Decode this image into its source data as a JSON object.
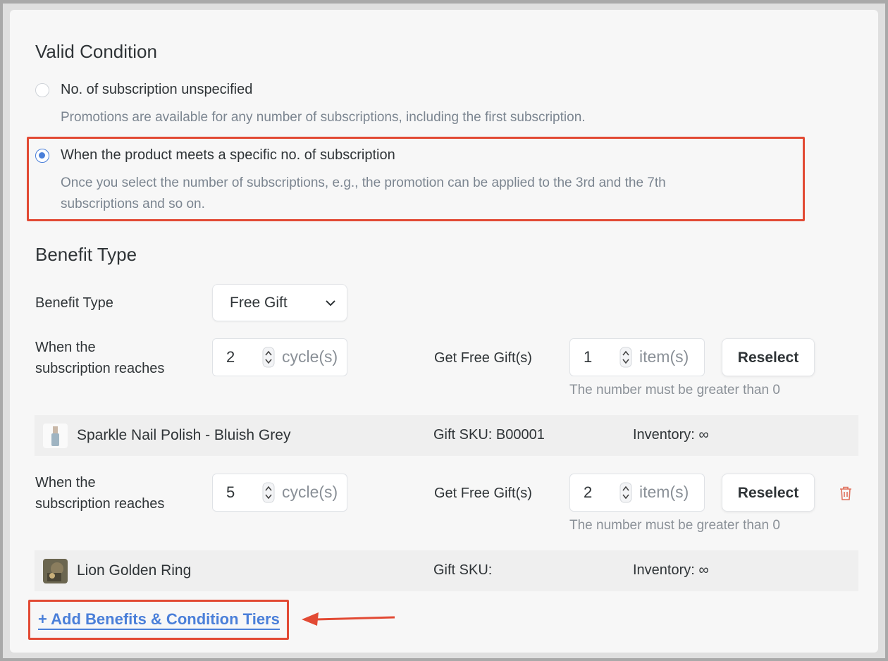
{
  "valid_condition": {
    "title": "Valid Condition",
    "options": [
      {
        "label": "No. of subscription unspecified",
        "description": "Promotions are available for any number of subscriptions, including the first subscription.",
        "selected": false
      },
      {
        "label": "When the product meets a specific no. of subscription",
        "description_line1": "Once you select the number of subscriptions, e.g., the promotion can be applied to the 3rd and the 7th",
        "description_line2": "subscriptions and so on.",
        "selected": true
      }
    ]
  },
  "benefit": {
    "title": "Benefit Type",
    "type_label": "Benefit Type",
    "type_value": "Free Gift",
    "tiers": [
      {
        "label_line1": "When the",
        "label_line2": "subscription reaches",
        "cycle_value": "2",
        "cycle_unit": "cycle(s)",
        "gift_label": "Get Free Gift(s)",
        "item_value": "1",
        "item_unit": "item(s)",
        "reselect_label": "Reselect",
        "hint": "The number must be greater than 0",
        "gift": {
          "name": "Sparkle Nail Polish - Bluish Grey",
          "sku": "Gift SKU: B00001",
          "inventory": "Inventory: ∞"
        }
      },
      {
        "label_line1": "When the",
        "label_line2": "subscription reaches",
        "cycle_value": "5",
        "cycle_unit": "cycle(s)",
        "gift_label": "Get Free Gift(s)",
        "item_value": "2",
        "item_unit": "item(s)",
        "reselect_label": "Reselect",
        "hint": "The number must be greater than 0",
        "gift": {
          "name": "Lion Golden Ring",
          "sku": "Gift SKU:",
          "inventory": "Inventory: ∞"
        }
      }
    ],
    "add_tier_label": "+ Add Benefits & Condition Tiers"
  },
  "colors": {
    "accent": "#4a7fd9",
    "highlight": "#e24a34",
    "delete": "#e0705c"
  },
  "icons": [
    "chevron-down-icon",
    "spinner-icon",
    "trash-icon",
    "arrow-icon"
  ]
}
